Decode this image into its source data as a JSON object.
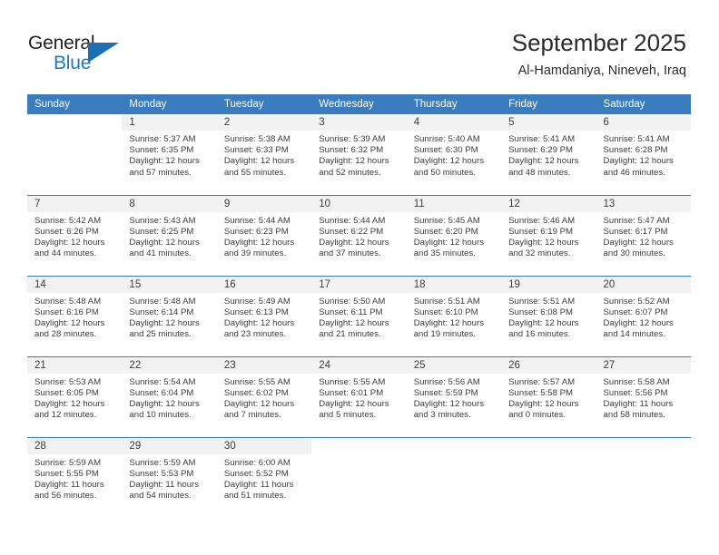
{
  "logo": {
    "word_top": "General",
    "word_bottom": "Blue",
    "triangle_color": "#1b6fb5",
    "text_color": "#231f20",
    "blue_color": "#1f7ac2"
  },
  "header": {
    "month_title": "September 2025",
    "location": "Al-Hamdaniya, Nineveh, Iraq"
  },
  "theme": {
    "header_blue": "#3a7cbe",
    "daynum_band": "#f2f2f2",
    "text": "#3c3c3c"
  },
  "weekday_headers": [
    "Sunday",
    "Monday",
    "Tuesday",
    "Wednesday",
    "Thursday",
    "Friday",
    "Saturday"
  ],
  "labels": {
    "sunrise_prefix": "Sunrise:",
    "sunset_prefix": "Sunset:",
    "daylight_prefix": "Daylight:"
  },
  "weeks": [
    [
      {
        "day": "",
        "sunrise": "",
        "sunset": "",
        "daylight_line1": "",
        "daylight_line2": "",
        "empty": true
      },
      {
        "day": "1",
        "sunrise": "Sunrise: 5:37 AM",
        "sunset": "Sunset: 6:35 PM",
        "daylight_line1": "Daylight: 12 hours",
        "daylight_line2": "and 57 minutes."
      },
      {
        "day": "2",
        "sunrise": "Sunrise: 5:38 AM",
        "sunset": "Sunset: 6:33 PM",
        "daylight_line1": "Daylight: 12 hours",
        "daylight_line2": "and 55 minutes."
      },
      {
        "day": "3",
        "sunrise": "Sunrise: 5:39 AM",
        "sunset": "Sunset: 6:32 PM",
        "daylight_line1": "Daylight: 12 hours",
        "daylight_line2": "and 52 minutes."
      },
      {
        "day": "4",
        "sunrise": "Sunrise: 5:40 AM",
        "sunset": "Sunset: 6:30 PM",
        "daylight_line1": "Daylight: 12 hours",
        "daylight_line2": "and 50 minutes."
      },
      {
        "day": "5",
        "sunrise": "Sunrise: 5:41 AM",
        "sunset": "Sunset: 6:29 PM",
        "daylight_line1": "Daylight: 12 hours",
        "daylight_line2": "and 48 minutes."
      },
      {
        "day": "6",
        "sunrise": "Sunrise: 5:41 AM",
        "sunset": "Sunset: 6:28 PM",
        "daylight_line1": "Daylight: 12 hours",
        "daylight_line2": "and 46 minutes."
      }
    ],
    [
      {
        "day": "7",
        "sunrise": "Sunrise: 5:42 AM",
        "sunset": "Sunset: 6:26 PM",
        "daylight_line1": "Daylight: 12 hours",
        "daylight_line2": "and 44 minutes."
      },
      {
        "day": "8",
        "sunrise": "Sunrise: 5:43 AM",
        "sunset": "Sunset: 6:25 PM",
        "daylight_line1": "Daylight: 12 hours",
        "daylight_line2": "and 41 minutes."
      },
      {
        "day": "9",
        "sunrise": "Sunrise: 5:44 AM",
        "sunset": "Sunset: 6:23 PM",
        "daylight_line1": "Daylight: 12 hours",
        "daylight_line2": "and 39 minutes."
      },
      {
        "day": "10",
        "sunrise": "Sunrise: 5:44 AM",
        "sunset": "Sunset: 6:22 PM",
        "daylight_line1": "Daylight: 12 hours",
        "daylight_line2": "and 37 minutes."
      },
      {
        "day": "11",
        "sunrise": "Sunrise: 5:45 AM",
        "sunset": "Sunset: 6:20 PM",
        "daylight_line1": "Daylight: 12 hours",
        "daylight_line2": "and 35 minutes."
      },
      {
        "day": "12",
        "sunrise": "Sunrise: 5:46 AM",
        "sunset": "Sunset: 6:19 PM",
        "daylight_line1": "Daylight: 12 hours",
        "daylight_line2": "and 32 minutes."
      },
      {
        "day": "13",
        "sunrise": "Sunrise: 5:47 AM",
        "sunset": "Sunset: 6:17 PM",
        "daylight_line1": "Daylight: 12 hours",
        "daylight_line2": "and 30 minutes."
      }
    ],
    [
      {
        "day": "14",
        "sunrise": "Sunrise: 5:48 AM",
        "sunset": "Sunset: 6:16 PM",
        "daylight_line1": "Daylight: 12 hours",
        "daylight_line2": "and 28 minutes."
      },
      {
        "day": "15",
        "sunrise": "Sunrise: 5:48 AM",
        "sunset": "Sunset: 6:14 PM",
        "daylight_line1": "Daylight: 12 hours",
        "daylight_line2": "and 25 minutes."
      },
      {
        "day": "16",
        "sunrise": "Sunrise: 5:49 AM",
        "sunset": "Sunset: 6:13 PM",
        "daylight_line1": "Daylight: 12 hours",
        "daylight_line2": "and 23 minutes."
      },
      {
        "day": "17",
        "sunrise": "Sunrise: 5:50 AM",
        "sunset": "Sunset: 6:11 PM",
        "daylight_line1": "Daylight: 12 hours",
        "daylight_line2": "and 21 minutes."
      },
      {
        "day": "18",
        "sunrise": "Sunrise: 5:51 AM",
        "sunset": "Sunset: 6:10 PM",
        "daylight_line1": "Daylight: 12 hours",
        "daylight_line2": "and 19 minutes."
      },
      {
        "day": "19",
        "sunrise": "Sunrise: 5:51 AM",
        "sunset": "Sunset: 6:08 PM",
        "daylight_line1": "Daylight: 12 hours",
        "daylight_line2": "and 16 minutes."
      },
      {
        "day": "20",
        "sunrise": "Sunrise: 5:52 AM",
        "sunset": "Sunset: 6:07 PM",
        "daylight_line1": "Daylight: 12 hours",
        "daylight_line2": "and 14 minutes."
      }
    ],
    [
      {
        "day": "21",
        "sunrise": "Sunrise: 5:53 AM",
        "sunset": "Sunset: 6:05 PM",
        "daylight_line1": "Daylight: 12 hours",
        "daylight_line2": "and 12 minutes."
      },
      {
        "day": "22",
        "sunrise": "Sunrise: 5:54 AM",
        "sunset": "Sunset: 6:04 PM",
        "daylight_line1": "Daylight: 12 hours",
        "daylight_line2": "and 10 minutes."
      },
      {
        "day": "23",
        "sunrise": "Sunrise: 5:55 AM",
        "sunset": "Sunset: 6:02 PM",
        "daylight_line1": "Daylight: 12 hours",
        "daylight_line2": "and 7 minutes."
      },
      {
        "day": "24",
        "sunrise": "Sunrise: 5:55 AM",
        "sunset": "Sunset: 6:01 PM",
        "daylight_line1": "Daylight: 12 hours",
        "daylight_line2": "and 5 minutes."
      },
      {
        "day": "25",
        "sunrise": "Sunrise: 5:56 AM",
        "sunset": "Sunset: 5:59 PM",
        "daylight_line1": "Daylight: 12 hours",
        "daylight_line2": "and 3 minutes."
      },
      {
        "day": "26",
        "sunrise": "Sunrise: 5:57 AM",
        "sunset": "Sunset: 5:58 PM",
        "daylight_line1": "Daylight: 12 hours",
        "daylight_line2": "and 0 minutes."
      },
      {
        "day": "27",
        "sunrise": "Sunrise: 5:58 AM",
        "sunset": "Sunset: 5:56 PM",
        "daylight_line1": "Daylight: 11 hours",
        "daylight_line2": "and 58 minutes."
      }
    ],
    [
      {
        "day": "28",
        "sunrise": "Sunrise: 5:59 AM",
        "sunset": "Sunset: 5:55 PM",
        "daylight_line1": "Daylight: 11 hours",
        "daylight_line2": "and 56 minutes."
      },
      {
        "day": "29",
        "sunrise": "Sunrise: 5:59 AM",
        "sunset": "Sunset: 5:53 PM",
        "daylight_line1": "Daylight: 11 hours",
        "daylight_line2": "and 54 minutes."
      },
      {
        "day": "30",
        "sunrise": "Sunrise: 6:00 AM",
        "sunset": "Sunset: 5:52 PM",
        "daylight_line1": "Daylight: 11 hours",
        "daylight_line2": "and 51 minutes."
      },
      {
        "day": "",
        "sunrise": "",
        "sunset": "",
        "daylight_line1": "",
        "daylight_line2": "",
        "empty": true
      },
      {
        "day": "",
        "sunrise": "",
        "sunset": "",
        "daylight_line1": "",
        "daylight_line2": "",
        "empty": true
      },
      {
        "day": "",
        "sunrise": "",
        "sunset": "",
        "daylight_line1": "",
        "daylight_line2": "",
        "empty": true
      },
      {
        "day": "",
        "sunrise": "",
        "sunset": "",
        "daylight_line1": "",
        "daylight_line2": "",
        "empty": true
      }
    ]
  ]
}
